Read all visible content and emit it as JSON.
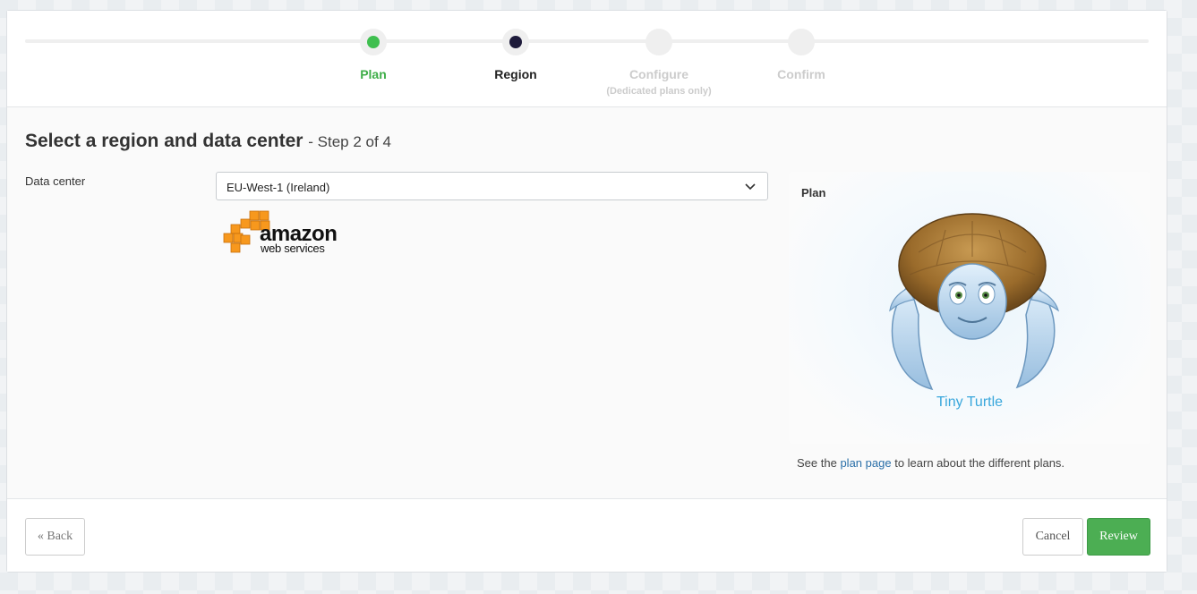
{
  "wizard": {
    "steps": [
      {
        "label": "Plan",
        "sub": "",
        "state": "done"
      },
      {
        "label": "Region",
        "sub": "",
        "state": "active"
      },
      {
        "label": "Configure",
        "sub": "(Dedicated plans only)",
        "state": "todo"
      },
      {
        "label": "Confirm",
        "sub": "",
        "state": "todo"
      }
    ]
  },
  "header": {
    "title": "Select a region and data center",
    "step_of": "- Step 2 of 4"
  },
  "form": {
    "datacenter_label": "Data center",
    "datacenter_value": "EU-West-1 (Ireland)",
    "provider_logo": "amazon web services"
  },
  "plan": {
    "title": "Plan",
    "name": "Tiny Turtle",
    "note_pre": "See the",
    "note_link": "plan page",
    "note_post": "to learn about the different plans."
  },
  "footer": {
    "back": "« Back",
    "cancel": "Cancel",
    "review": "Review"
  },
  "colors": {
    "done": "#3fbf4f",
    "active": "#1e1b3b",
    "review_button": "#4cae53",
    "plan_name": "#3aa7dc"
  }
}
